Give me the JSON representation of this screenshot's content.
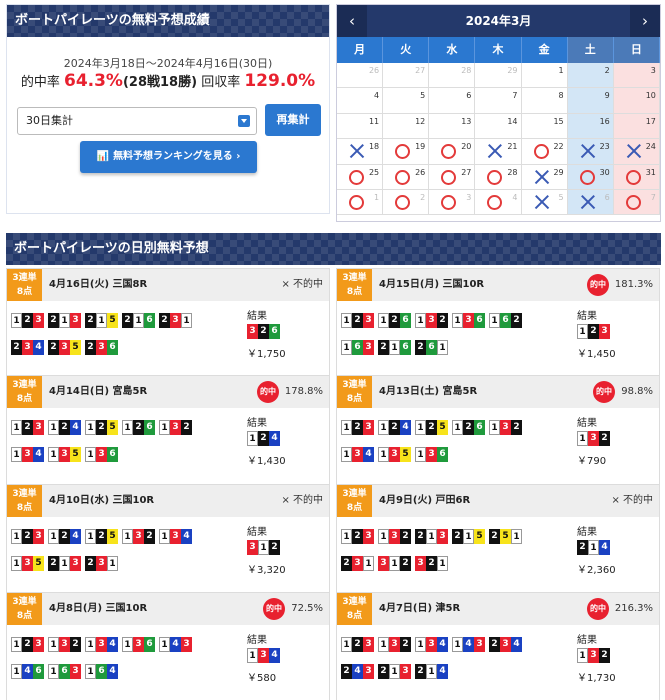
{
  "summary": {
    "title": "ボートパイレーツの無料予想成績",
    "date_range": "2024年3月18日～2024年4月16日(30日)",
    "hit_rate_label": "的中率",
    "hit_rate": "64.3%",
    "record": "(28戦18勝)",
    "return_rate_label": "回収率",
    "return_rate": "129.0%",
    "period_value": "30日集計",
    "recalc_label": "再集計",
    "ranking_label": "無料予想ランキングを見る"
  },
  "calendar": {
    "title": "2024年3月",
    "weekdays": [
      "月",
      "火",
      "水",
      "木",
      "金",
      "土",
      "日"
    ],
    "weeks": [
      [
        {
          "d": "26",
          "g": true
        },
        {
          "d": "27",
          "g": true
        },
        {
          "d": "28",
          "g": true
        },
        {
          "d": "29",
          "g": true
        },
        {
          "d": "1"
        },
        {
          "d": "2"
        },
        {
          "d": "3"
        }
      ],
      [
        {
          "d": "4"
        },
        {
          "d": "5"
        },
        {
          "d": "6"
        },
        {
          "d": "7"
        },
        {
          "d": "8"
        },
        {
          "d": "9"
        },
        {
          "d": "10"
        }
      ],
      [
        {
          "d": "11"
        },
        {
          "d": "12"
        },
        {
          "d": "13"
        },
        {
          "d": "14"
        },
        {
          "d": "15"
        },
        {
          "d": "16"
        },
        {
          "d": "17"
        }
      ],
      [
        {
          "d": "18",
          "m": "x"
        },
        {
          "d": "19",
          "m": "o"
        },
        {
          "d": "20",
          "m": "o"
        },
        {
          "d": "21",
          "m": "x"
        },
        {
          "d": "22",
          "m": "o"
        },
        {
          "d": "23",
          "m": "x"
        },
        {
          "d": "24",
          "m": "x"
        }
      ],
      [
        {
          "d": "25",
          "m": "o"
        },
        {
          "d": "26",
          "m": "o"
        },
        {
          "d": "27",
          "m": "o"
        },
        {
          "d": "28",
          "m": "o"
        },
        {
          "d": "29",
          "m": "x"
        },
        {
          "d": "30",
          "m": "o"
        },
        {
          "d": "31",
          "m": "o"
        }
      ],
      [
        {
          "d": "1",
          "m": "o",
          "g": true
        },
        {
          "d": "2",
          "m": "o",
          "g": true
        },
        {
          "d": "3",
          "m": "o",
          "g": true
        },
        {
          "d": "4",
          "m": "o",
          "g": true
        },
        {
          "d": "5",
          "m": "x",
          "g": true
        },
        {
          "d": "6",
          "m": "x",
          "g": true
        },
        {
          "d": "7",
          "m": "o",
          "g": true
        }
      ]
    ]
  },
  "daily": {
    "title": "ボートパイレーツの日別無料予想",
    "result_label": "結果",
    "bet_badge": [
      "3連単",
      "8点"
    ],
    "hit_label": "的中",
    "cards": [
      {
        "race": "4月16日(火) 三国8R",
        "hit": false,
        "status": "× 不的中",
        "combos": [
          "123",
          "213",
          "215",
          "216",
          "231",
          "234",
          "235",
          "236"
        ],
        "result": "326",
        "payout": "￥1,750"
      },
      {
        "race": "4月15日(月) 三国10R",
        "hit": true,
        "status": "181.3%",
        "combos": [
          "123",
          "126",
          "132",
          "136",
          "162",
          "163",
          "216",
          "261"
        ],
        "result": "123",
        "payout": "￥1,450"
      },
      {
        "race": "4月14日(日) 宮島5R",
        "hit": true,
        "status": "178.8%",
        "combos": [
          "123",
          "124",
          "125",
          "126",
          "132",
          "134",
          "135",
          "136"
        ],
        "result": "124",
        "payout": "￥1,430"
      },
      {
        "race": "4月13日(土) 宮島5R",
        "hit": true,
        "status": "98.8%",
        "combos": [
          "123",
          "124",
          "125",
          "126",
          "132",
          "134",
          "135",
          "136"
        ],
        "result": "132",
        "payout": "￥790"
      },
      {
        "race": "4月10日(水) 三国10R",
        "hit": false,
        "status": "× 不的中",
        "combos": [
          "123",
          "124",
          "125",
          "132",
          "134",
          "135",
          "213",
          "231"
        ],
        "result": "312",
        "payout": "￥3,320"
      },
      {
        "race": "4月9日(火) 戸田6R",
        "hit": false,
        "status": "× 不的中",
        "combos": [
          "123",
          "132",
          "213",
          "215",
          "251",
          "231",
          "312",
          "321"
        ],
        "result": "214",
        "payout": "￥2,360"
      },
      {
        "race": "4月8日(月) 三国10R",
        "hit": true,
        "status": "72.5%",
        "combos": [
          "123",
          "132",
          "134",
          "136",
          "143",
          "146",
          "163",
          "164"
        ],
        "result": "134",
        "payout": "￥580"
      },
      {
        "race": "4月7日(日) 津5R",
        "hit": true,
        "status": "216.3%",
        "combos": [
          "123",
          "132",
          "134",
          "143",
          "234",
          "243",
          "213",
          "214"
        ],
        "result": "132",
        "payout": "￥1,730"
      }
    ]
  }
}
